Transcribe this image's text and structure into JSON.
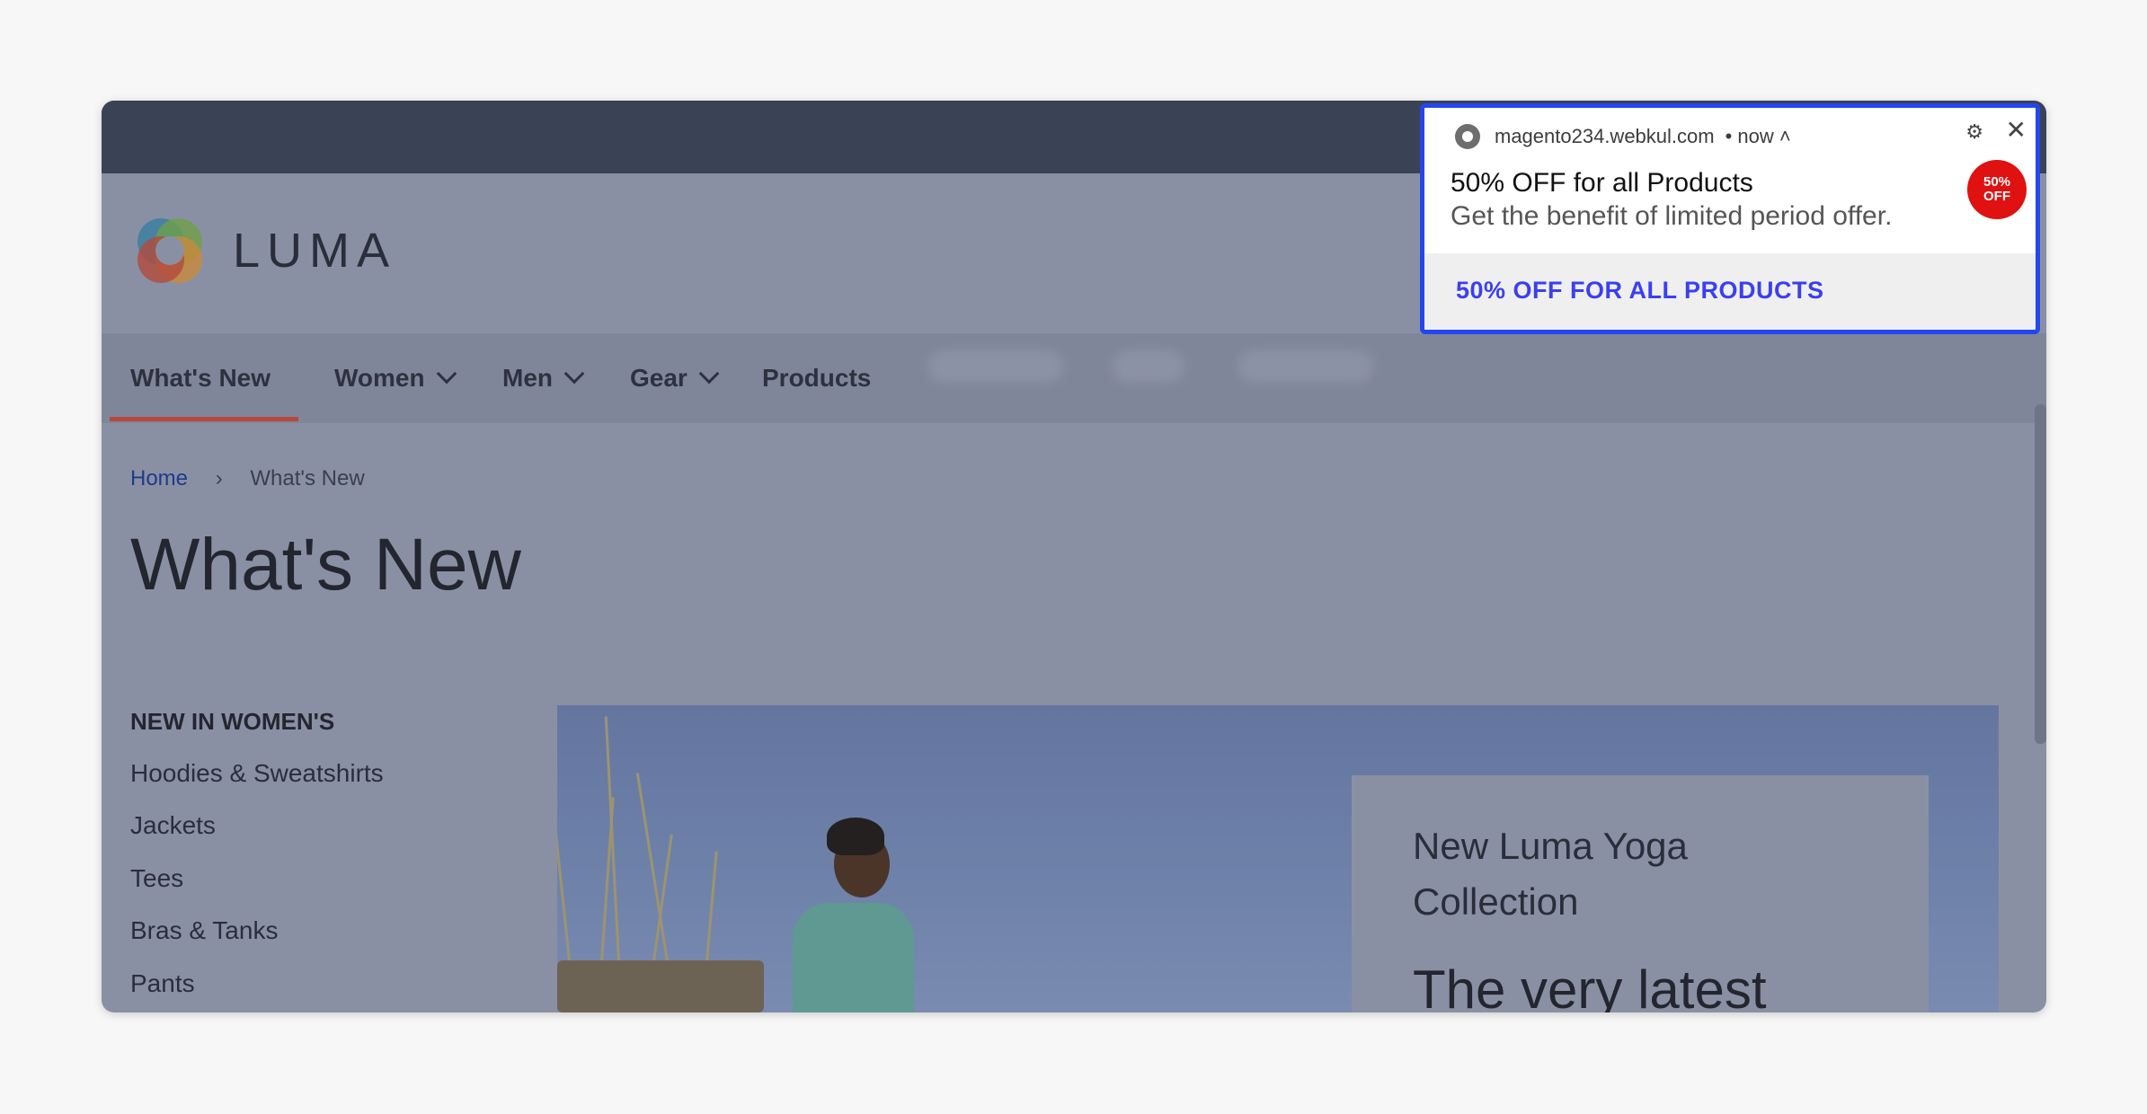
{
  "brand": {
    "name": "LUMA"
  },
  "nav": {
    "items": [
      {
        "label": "What's New",
        "active": true
      },
      {
        "label": "Women",
        "dropdown": true
      },
      {
        "label": "Men",
        "dropdown": true
      },
      {
        "label": "Gear",
        "dropdown": true
      },
      {
        "label": "Products"
      }
    ]
  },
  "breadcrumb": {
    "home": "Home",
    "current": "What's New"
  },
  "page": {
    "title": "What's New"
  },
  "sidebar": {
    "heading": "NEW IN WOMEN'S",
    "links": [
      "Hoodies & Sweatshirts",
      "Jackets",
      "Tees",
      "Bras & Tanks",
      "Pants"
    ]
  },
  "hero": {
    "line1": "New Luma Yoga",
    "line2": "Collection",
    "line3": "The very latest"
  },
  "notification": {
    "site": "magento234.webkul.com",
    "time": "• now ˄",
    "title": "50% OFF for all Products",
    "body": "Get the benefit of limited period offer.",
    "badge_line1": "50%",
    "badge_line2": "OFF",
    "action": "50% OFF FOR ALL PRODUCTS",
    "gear": "⚙",
    "close": "✕"
  },
  "colors": {
    "accent_active": "#b6483e",
    "notification_border": "#2446f0",
    "action_text": "#3b3ff0",
    "badge": "#e01111"
  }
}
